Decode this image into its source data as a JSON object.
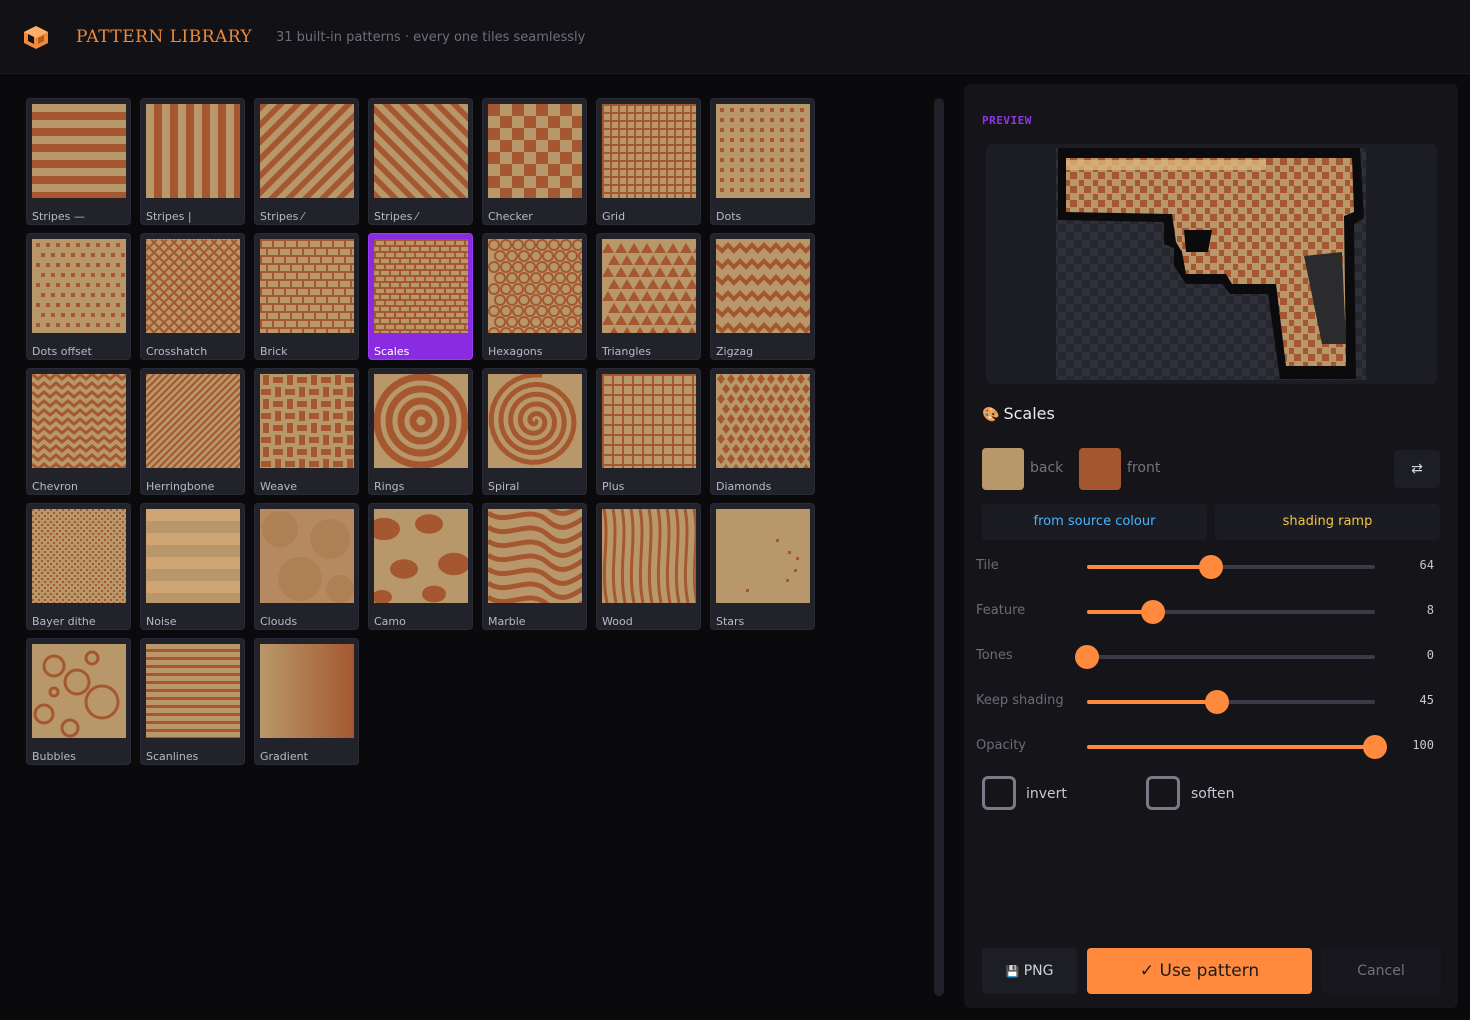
{
  "header": {
    "title": "PATTERN LIBRARY",
    "subtitle": "31 built-in patterns · every one tiles seamlessly"
  },
  "colors": {
    "back": "#b8986a",
    "front": "#a5582f",
    "accent": "#ff8a3d",
    "selection": "#8a2be2"
  },
  "patterns": [
    {
      "label": "Stripes —",
      "kind": "stripes-h"
    },
    {
      "label": "Stripes |",
      "kind": "stripes-v"
    },
    {
      "label": "Stripes ⁄",
      "kind": "stripes-d1"
    },
    {
      "label": "Stripes ⁄",
      "kind": "stripes-d2"
    },
    {
      "label": "Checker",
      "kind": "checker"
    },
    {
      "label": "Grid",
      "kind": "grid"
    },
    {
      "label": "Dots",
      "kind": "dots"
    },
    {
      "label": "Dots offset",
      "kind": "dots-offset"
    },
    {
      "label": "Crosshatch",
      "kind": "crosshatch"
    },
    {
      "label": "Brick",
      "kind": "brick"
    },
    {
      "label": "Scales",
      "kind": "scales",
      "selected": true
    },
    {
      "label": "Hexagons",
      "kind": "hexagons"
    },
    {
      "label": "Triangles",
      "kind": "triangles"
    },
    {
      "label": "Zigzag",
      "kind": "zigzag"
    },
    {
      "label": "Chevron",
      "kind": "chevron"
    },
    {
      "label": "Herringbone",
      "kind": "herringbone"
    },
    {
      "label": "Weave",
      "kind": "weave"
    },
    {
      "label": "Rings",
      "kind": "rings"
    },
    {
      "label": "Spiral",
      "kind": "spiral"
    },
    {
      "label": "Plus",
      "kind": "plus"
    },
    {
      "label": "Diamonds",
      "kind": "diamonds"
    },
    {
      "label": "Bayer dithe",
      "kind": "bayer"
    },
    {
      "label": "Noise",
      "kind": "noise"
    },
    {
      "label": "Clouds",
      "kind": "clouds"
    },
    {
      "label": "Camo",
      "kind": "camo"
    },
    {
      "label": "Marble",
      "kind": "marble"
    },
    {
      "label": "Wood",
      "kind": "wood"
    },
    {
      "label": "Stars",
      "kind": "stars"
    },
    {
      "label": "Bubbles",
      "kind": "bubbles"
    },
    {
      "label": "Scanlines",
      "kind": "scanlines"
    },
    {
      "label": "Gradient",
      "kind": "gradient"
    }
  ],
  "panel": {
    "preview_label": "PREVIEW",
    "pattern_name": "Scales",
    "pattern_icon": "palette-icon",
    "back_label": "back",
    "front_label": "front",
    "swap_icon": "⇄",
    "mode_source": "from source colour",
    "mode_ramp": "shading ramp",
    "mode_source_color": "#4ab5ff",
    "mode_ramp_color": "#f2c744",
    "sliders": [
      {
        "label": "Tile",
        "value": "64",
        "fraction": 0.43
      },
      {
        "label": "Feature",
        "value": "8",
        "fraction": 0.23
      },
      {
        "label": "Tones",
        "value": "0",
        "fraction": 0.0
      },
      {
        "label": "Keep shading",
        "value": "45",
        "fraction": 0.45
      },
      {
        "label": "Opacity",
        "value": "100",
        "fraction": 1.0
      }
    ],
    "invert_label": "invert",
    "soften_label": "soften",
    "png_label": "PNG",
    "png_icon": "💾",
    "use_label": "✓  Use pattern",
    "cancel_label": "Cancel"
  }
}
